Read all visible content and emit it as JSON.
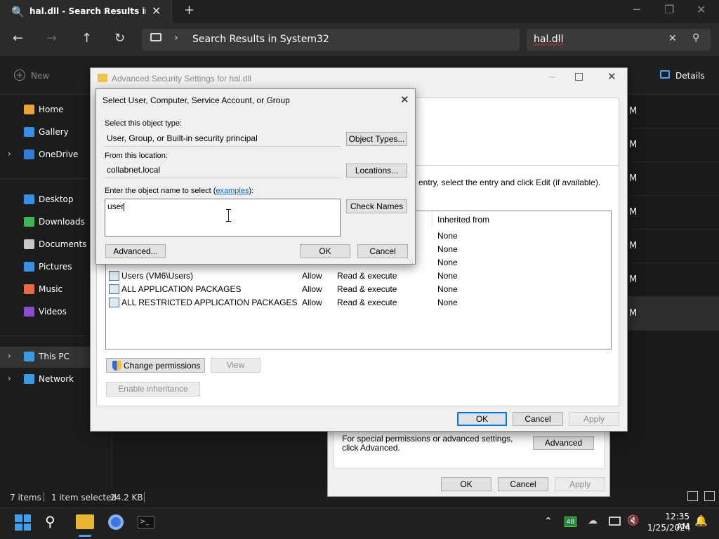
{
  "explorer": {
    "tab_title": "hal.dll - Search Results in Syste",
    "address": "Search Results in System32",
    "search_value": "hal.dll",
    "new_label": "New",
    "details_label": "Details",
    "sidebar": [
      {
        "label": "Home",
        "icon": "home-icon",
        "color": "#e8a33d"
      },
      {
        "label": "Gallery",
        "icon": "gallery-icon",
        "color": "#3a8ee6"
      },
      {
        "label": "OneDrive",
        "icon": "cloud-icon",
        "color": "#2f7fd6"
      },
      {
        "label": "Desktop",
        "icon": "desktop-icon",
        "color": "#3a8ee6"
      },
      {
        "label": "Downloads",
        "icon": "download-icon",
        "color": "#3fb55a"
      },
      {
        "label": "Documents",
        "icon": "document-icon",
        "color": "#c9c9c9"
      },
      {
        "label": "Pictures",
        "icon": "pictures-icon",
        "color": "#3a8ee6"
      },
      {
        "label": "Music",
        "icon": "music-icon",
        "color": "#e8684a"
      },
      {
        "label": "Videos",
        "icon": "videos-icon",
        "color": "#8a4fd1"
      },
      {
        "label": "This PC",
        "icon": "pc-icon",
        "color": "#3a9be6"
      },
      {
        "label": "Network",
        "icon": "network-icon",
        "color": "#3a9be6"
      }
    ],
    "right_col_letter": "M",
    "status": {
      "items": "7 items",
      "selected": "1 item selected",
      "size": "24.2 KB"
    }
  },
  "back_dialog": {
    "text": "For special permissions or advanced settings, click Advanced.",
    "advanced_label": "Advanced",
    "ok_label": "OK",
    "cancel_label": "Cancel",
    "apply_label": "Apply"
  },
  "advanced": {
    "title": "Advanced Security Settings for hal.dll",
    "instruction": "entry, select the entry and click Edit (if available).",
    "col_inherited": "Inherited from",
    "rows": [
      {
        "principal": "",
        "type": "",
        "access": "",
        "inherited": "None"
      },
      {
        "principal": "",
        "type": "",
        "access": "",
        "inherited": "None"
      },
      {
        "principal": "",
        "type": "",
        "access": "",
        "inherited": "None"
      },
      {
        "principal": "Users (VM6\\Users)",
        "type": "Allow",
        "access": "Read & execute",
        "inherited": "None"
      },
      {
        "principal": "ALL APPLICATION PACKAGES",
        "type": "Allow",
        "access": "Read & execute",
        "inherited": "None"
      },
      {
        "principal": "ALL RESTRICTED APPLICATION PACKAGES",
        "type": "Allow",
        "access": "Read & execute",
        "inherited": "None"
      }
    ],
    "change_permissions": "Change permissions",
    "view": "View",
    "enable_inheritance": "Enable inheritance",
    "ok_label": "OK",
    "cancel_label": "Cancel",
    "apply_label": "Apply"
  },
  "select": {
    "title": "Select User, Computer, Service Account, or Group",
    "object_type_label": "Select this object type:",
    "object_type_value": "User, Group, or Built-in security principal",
    "object_types_button": "Object Types...",
    "location_label": "From this location:",
    "location_value": "collabnet.local",
    "locations_button": "Locations...",
    "enter_label": "Enter the object name to select (",
    "examples_link": "examples",
    "enter_label_end": "):",
    "name_value": "user",
    "check_names": "Check Names",
    "advanced_button": "Advanced...",
    "ok_label": "OK",
    "cancel_label": "Cancel"
  },
  "taskbar": {
    "time": "12:35 AM",
    "date": "1/25/2024",
    "tray_badge": "48"
  }
}
